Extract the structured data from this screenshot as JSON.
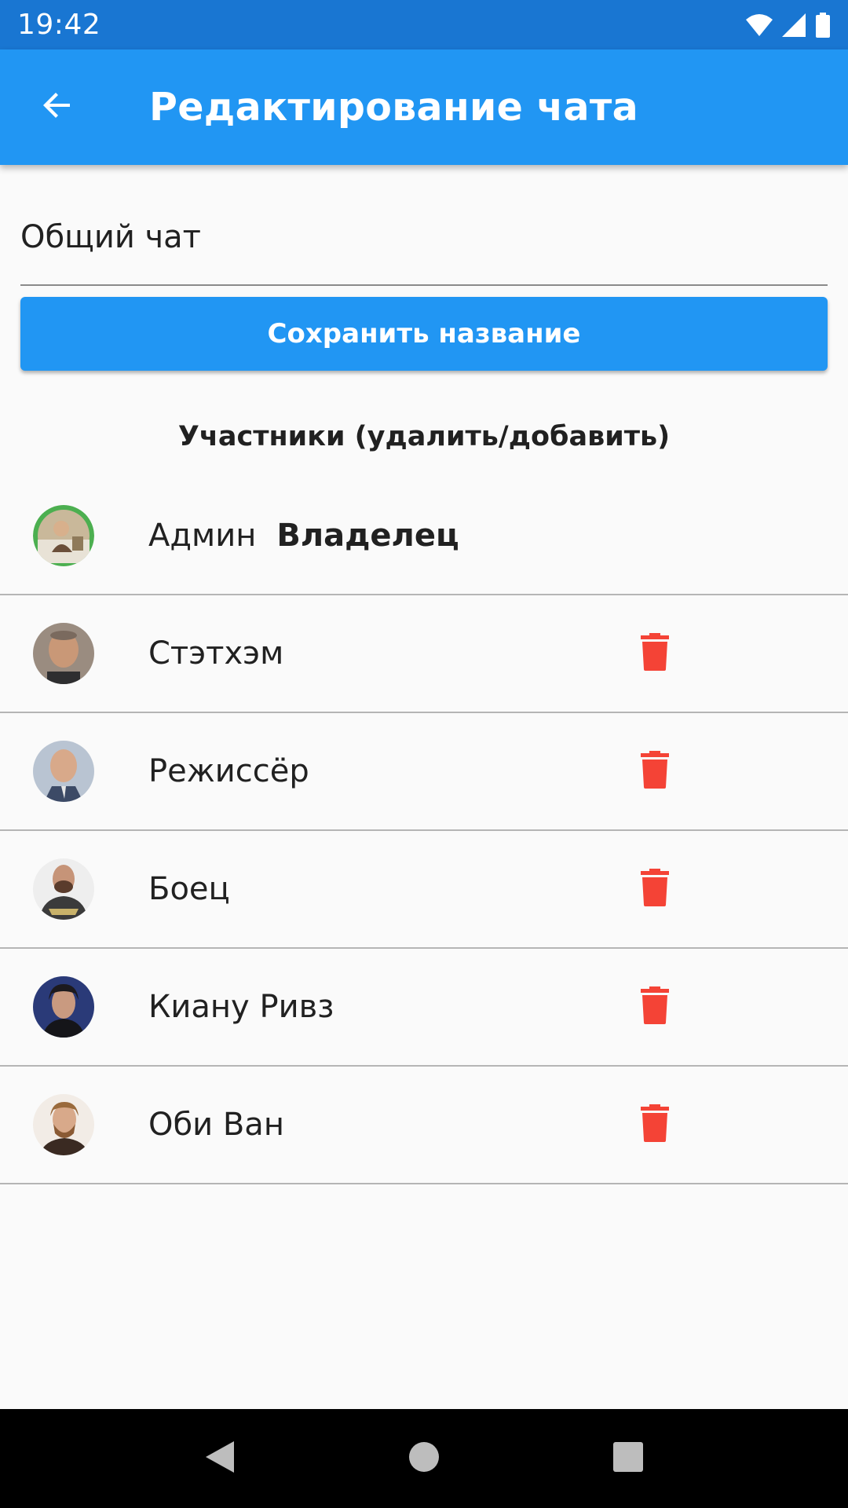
{
  "status_bar": {
    "time": "19:42",
    "icons": [
      "wifi-icon",
      "signal-icon",
      "battery-icon"
    ]
  },
  "app_bar": {
    "back_icon": "arrow-back-icon",
    "title": "Редактирование чата"
  },
  "chat_name": {
    "value": "Общий чат",
    "placeholder": ""
  },
  "save_button": {
    "label": "Сохранить название"
  },
  "members_section": {
    "title": "Участники (удалить/добавить)"
  },
  "members": [
    {
      "name": "Админ",
      "badge": "Владелец",
      "deletable": false
    },
    {
      "name": "Стэтхэм",
      "badge": "",
      "deletable": true
    },
    {
      "name": "Режиссёр",
      "badge": "",
      "deletable": true
    },
    {
      "name": "Боец",
      "badge": "",
      "deletable": true
    },
    {
      "name": "Киану Ривз",
      "badge": "",
      "deletable": true
    },
    {
      "name": "Оби Ван",
      "badge": "",
      "deletable": true
    }
  ],
  "colors": {
    "status_bar": "#1976d2",
    "app_bar": "#2196f3",
    "button": "#2196f3",
    "delete_icon": "#f44336",
    "owner_ring": "#4caf50"
  },
  "nav_bar": {
    "icons": [
      "back-triangle-icon",
      "home-circle-icon",
      "recents-square-icon"
    ]
  }
}
